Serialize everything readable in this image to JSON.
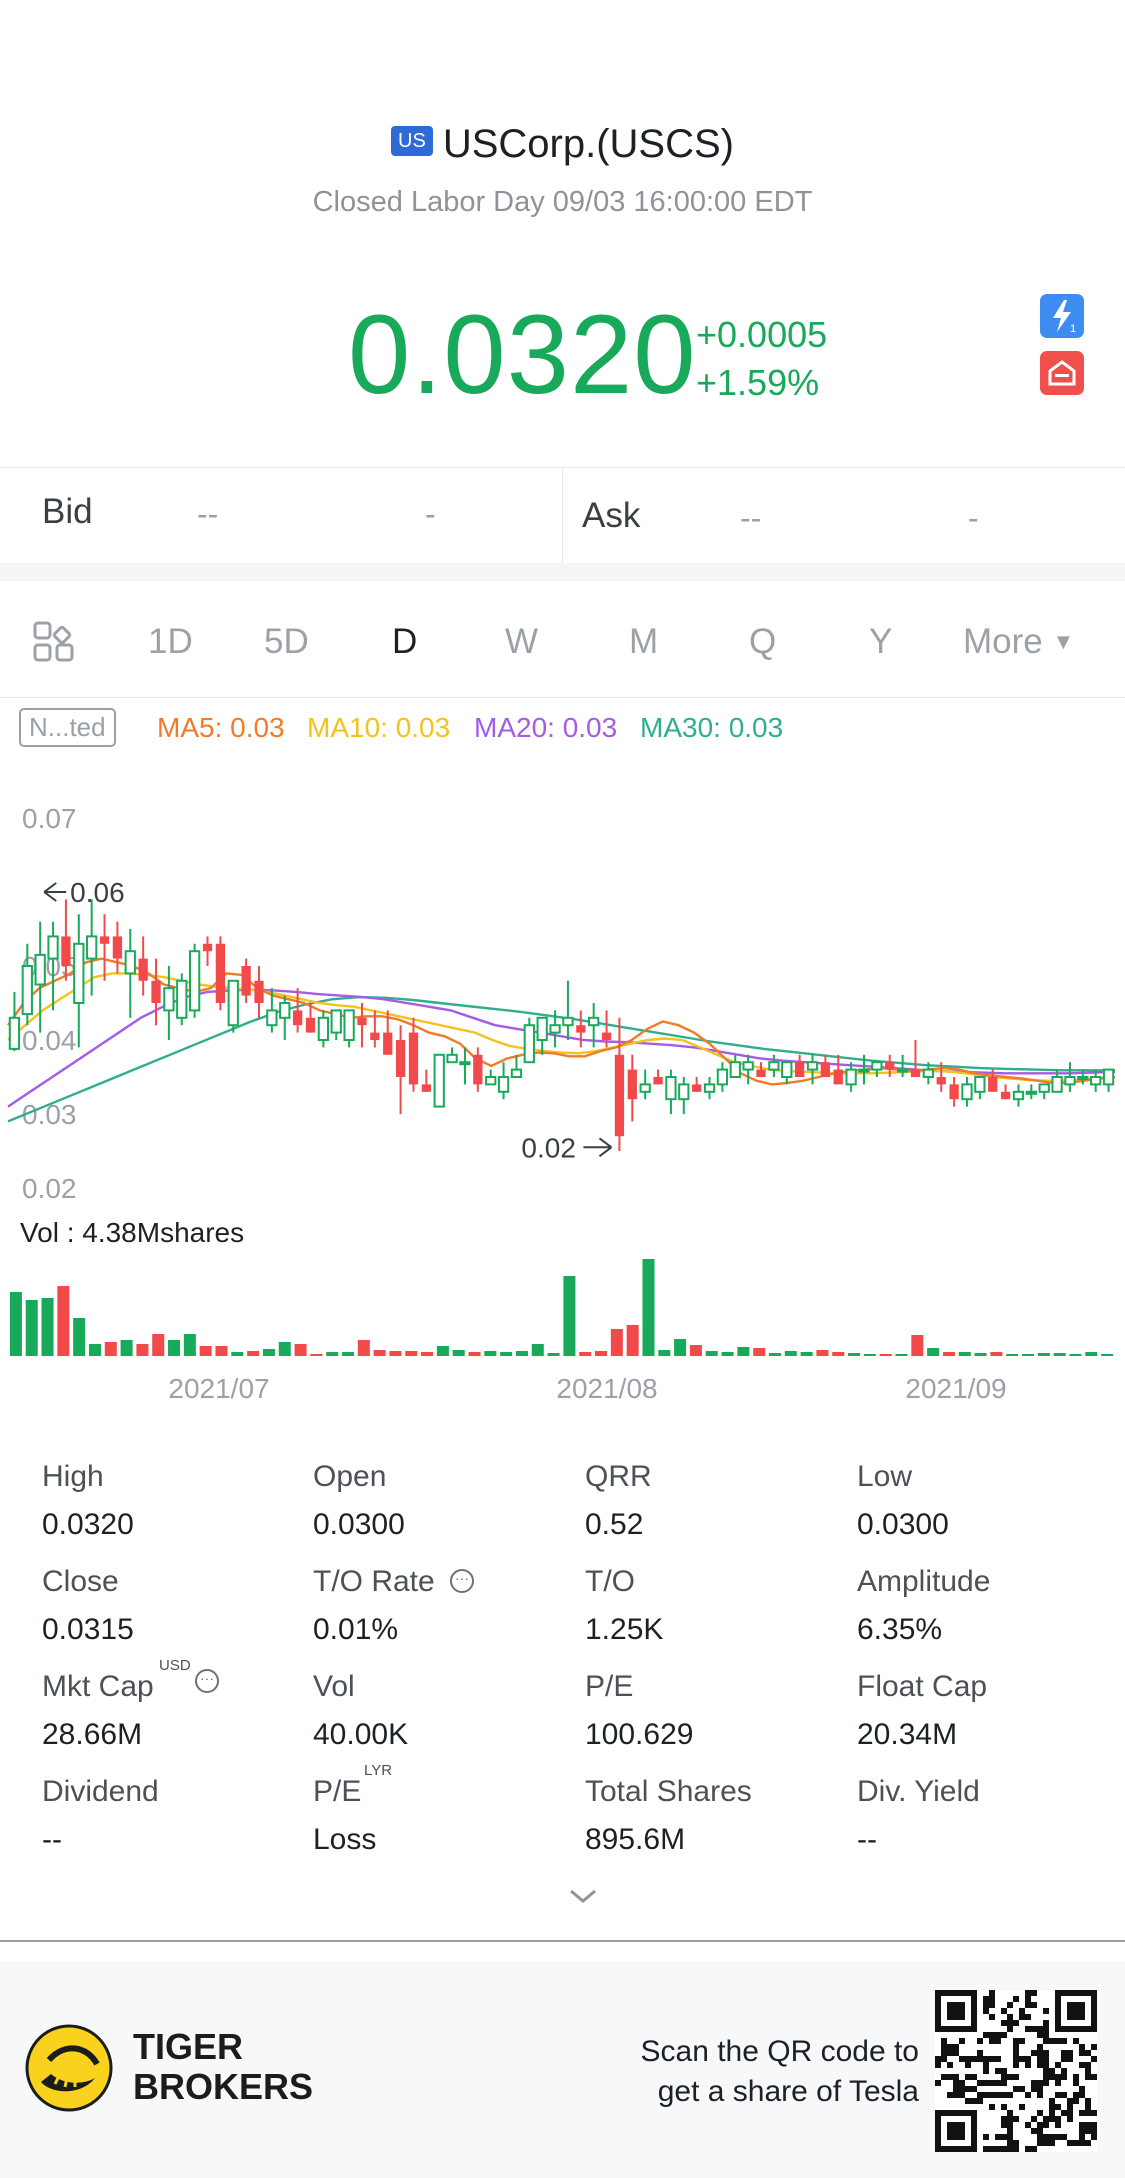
{
  "header": {
    "market_flag": "US",
    "name": "USCorp.(USCS)",
    "status": "Closed Labor Day 09/03 16:00:00 EDT",
    "price": "0.0320",
    "change": "+0.0005",
    "change_pct": "+1.59%",
    "accent_color": "#18a95a"
  },
  "quote": {
    "bid_label": "Bid",
    "bid_price": "--",
    "bid_size": "-",
    "ask_label": "Ask",
    "ask_price": "--",
    "ask_size": "-"
  },
  "tabs": {
    "items": [
      "1D",
      "5D",
      "D",
      "W",
      "M",
      "Q",
      "Y",
      "More"
    ],
    "active": "D"
  },
  "indicators": {
    "mode_label": "N...ted",
    "ma5": "MA5: 0.03",
    "ma10": "MA10: 0.03",
    "ma20": "MA20: 0.03",
    "ma30": "MA30: 0.03",
    "colors": {
      "ma5": "#f07b28",
      "ma10": "#f3c21b",
      "ma20": "#a45ce6",
      "ma30": "#2fae8f"
    }
  },
  "chart_data": {
    "type": "candlestick",
    "y_tick_labels": [
      "0.07",
      "0.05",
      "0.04",
      "0.03",
      "0.02"
    ],
    "ylim": [
      0.02,
      0.07
    ],
    "x_tick_labels": [
      "2021/07",
      "2021/08",
      "2021/09"
    ],
    "max_annotation": "0.06",
    "min_annotation": "0.02",
    "volume_label": "Vol  : 4.38Mshares",
    "colors": {
      "up": "#18a95a",
      "down": "#f24a4a"
    },
    "candles": [
      {
        "o": 0.0388,
        "h": 0.0465,
        "l": 0.0385,
        "c": 0.043
      },
      {
        "o": 0.0435,
        "h": 0.053,
        "l": 0.042,
        "c": 0.05
      },
      {
        "o": 0.0475,
        "h": 0.056,
        "l": 0.041,
        "c": 0.0515
      },
      {
        "o": 0.051,
        "h": 0.056,
        "l": 0.044,
        "c": 0.054
      },
      {
        "o": 0.054,
        "h": 0.059,
        "l": 0.048,
        "c": 0.05
      },
      {
        "o": 0.045,
        "h": 0.057,
        "l": 0.039,
        "c": 0.053
      },
      {
        "o": 0.051,
        "h": 0.059,
        "l": 0.046,
        "c": 0.054
      },
      {
        "o": 0.054,
        "h": 0.057,
        "l": 0.048,
        "c": 0.053
      },
      {
        "o": 0.054,
        "h": 0.056,
        "l": 0.049,
        "c": 0.051
      },
      {
        "o": 0.049,
        "h": 0.055,
        "l": 0.043,
        "c": 0.052
      },
      {
        "o": 0.051,
        "h": 0.054,
        "l": 0.046,
        "c": 0.048
      },
      {
        "o": 0.048,
        "h": 0.051,
        "l": 0.042,
        "c": 0.045
      },
      {
        "o": 0.044,
        "h": 0.05,
        "l": 0.04,
        "c": 0.047
      },
      {
        "o": 0.043,
        "h": 0.049,
        "l": 0.042,
        "c": 0.048
      },
      {
        "o": 0.044,
        "h": 0.053,
        "l": 0.043,
        "c": 0.052
      },
      {
        "o": 0.053,
        "h": 0.054,
        "l": 0.05,
        "c": 0.052
      },
      {
        "o": 0.053,
        "h": 0.054,
        "l": 0.044,
        "c": 0.045
      },
      {
        "o": 0.042,
        "h": 0.047,
        "l": 0.041,
        "c": 0.048
      },
      {
        "o": 0.05,
        "h": 0.051,
        "l": 0.045,
        "c": 0.046
      },
      {
        "o": 0.048,
        "h": 0.05,
        "l": 0.043,
        "c": 0.045
      },
      {
        "o": 0.042,
        "h": 0.047,
        "l": 0.041,
        "c": 0.044
      },
      {
        "o": 0.043,
        "h": 0.046,
        "l": 0.04,
        "c": 0.045
      },
      {
        "o": 0.044,
        "h": 0.047,
        "l": 0.041,
        "c": 0.042
      },
      {
        "o": 0.043,
        "h": 0.045,
        "l": 0.041,
        "c": 0.041
      },
      {
        "o": 0.04,
        "h": 0.044,
        "l": 0.039,
        "c": 0.043
      },
      {
        "o": 0.041,
        "h": 0.044,
        "l": 0.04,
        "c": 0.044
      },
      {
        "o": 0.04,
        "h": 0.044,
        "l": 0.039,
        "c": 0.044
      },
      {
        "o": 0.043,
        "h": 0.045,
        "l": 0.039,
        "c": 0.042
      },
      {
        "o": 0.041,
        "h": 0.044,
        "l": 0.039,
        "c": 0.04
      },
      {
        "o": 0.041,
        "h": 0.044,
        "l": 0.039,
        "c": 0.038
      },
      {
        "o": 0.04,
        "h": 0.042,
        "l": 0.03,
        "c": 0.035
      },
      {
        "o": 0.041,
        "h": 0.043,
        "l": 0.033,
        "c": 0.034
      },
      {
        "o": 0.034,
        "h": 0.036,
        "l": 0.033,
        "c": 0.033
      },
      {
        "o": 0.031,
        "h": 0.038,
        "l": 0.031,
        "c": 0.038
      },
      {
        "o": 0.037,
        "h": 0.039,
        "l": 0.037,
        "c": 0.038
      },
      {
        "o": 0.037,
        "h": 0.039,
        "l": 0.034,
        "c": 0.037
      },
      {
        "o": 0.038,
        "h": 0.039,
        "l": 0.033,
        "c": 0.034
      },
      {
        "o": 0.034,
        "h": 0.036,
        "l": 0.034,
        "c": 0.035
      },
      {
        "o": 0.033,
        "h": 0.037,
        "l": 0.032,
        "c": 0.035
      },
      {
        "o": 0.035,
        "h": 0.038,
        "l": 0.035,
        "c": 0.036
      },
      {
        "o": 0.037,
        "h": 0.043,
        "l": 0.037,
        "c": 0.042
      },
      {
        "o": 0.04,
        "h": 0.043,
        "l": 0.038,
        "c": 0.043
      },
      {
        "o": 0.041,
        "h": 0.044,
        "l": 0.039,
        "c": 0.042
      },
      {
        "o": 0.042,
        "h": 0.048,
        "l": 0.04,
        "c": 0.043
      },
      {
        "o": 0.042,
        "h": 0.044,
        "l": 0.039,
        "c": 0.041
      },
      {
        "o": 0.042,
        "h": 0.045,
        "l": 0.039,
        "c": 0.043
      },
      {
        "o": 0.041,
        "h": 0.044,
        "l": 0.039,
        "c": 0.04
      },
      {
        "o": 0.038,
        "h": 0.043,
        "l": 0.025,
        "c": 0.027
      },
      {
        "o": 0.036,
        "h": 0.038,
        "l": 0.029,
        "c": 0.032
      },
      {
        "o": 0.033,
        "h": 0.036,
        "l": 0.032,
        "c": 0.034
      },
      {
        "o": 0.035,
        "h": 0.036,
        "l": 0.034,
        "c": 0.034
      },
      {
        "o": 0.032,
        "h": 0.036,
        "l": 0.03,
        "c": 0.035
      },
      {
        "o": 0.032,
        "h": 0.035,
        "l": 0.03,
        "c": 0.034
      },
      {
        "o": 0.034,
        "h": 0.035,
        "l": 0.033,
        "c": 0.033
      },
      {
        "o": 0.033,
        "h": 0.035,
        "l": 0.032,
        "c": 0.034
      },
      {
        "o": 0.034,
        "h": 0.037,
        "l": 0.033,
        "c": 0.036
      },
      {
        "o": 0.035,
        "h": 0.038,
        "l": 0.035,
        "c": 0.037
      },
      {
        "o": 0.036,
        "h": 0.038,
        "l": 0.034,
        "c": 0.037
      },
      {
        "o": 0.036,
        "h": 0.037,
        "l": 0.035,
        "c": 0.035
      },
      {
        "o": 0.036,
        "h": 0.038,
        "l": 0.035,
        "c": 0.037
      },
      {
        "o": 0.035,
        "h": 0.037,
        "l": 0.034,
        "c": 0.037
      },
      {
        "o": 0.037,
        "h": 0.038,
        "l": 0.035,
        "c": 0.035
      },
      {
        "o": 0.036,
        "h": 0.038,
        "l": 0.034,
        "c": 0.037
      },
      {
        "o": 0.037,
        "h": 0.038,
        "l": 0.035,
        "c": 0.035
      },
      {
        "o": 0.036,
        "h": 0.038,
        "l": 0.035,
        "c": 0.034
      },
      {
        "o": 0.034,
        "h": 0.037,
        "l": 0.033,
        "c": 0.036
      },
      {
        "o": 0.036,
        "h": 0.038,
        "l": 0.034,
        "c": 0.036
      },
      {
        "o": 0.036,
        "h": 0.037,
        "l": 0.035,
        "c": 0.037
      },
      {
        "o": 0.037,
        "h": 0.038,
        "l": 0.035,
        "c": 0.036
      },
      {
        "o": 0.036,
        "h": 0.038,
        "l": 0.035,
        "c": 0.036
      },
      {
        "o": 0.036,
        "h": 0.04,
        "l": 0.035,
        "c": 0.035
      },
      {
        "o": 0.035,
        "h": 0.037,
        "l": 0.034,
        "c": 0.036
      },
      {
        "o": 0.035,
        "h": 0.037,
        "l": 0.033,
        "c": 0.034
      },
      {
        "o": 0.034,
        "h": 0.035,
        "l": 0.031,
        "c": 0.032
      },
      {
        "o": 0.032,
        "h": 0.035,
        "l": 0.031,
        "c": 0.034
      },
      {
        "o": 0.033,
        "h": 0.035,
        "l": 0.032,
        "c": 0.035
      },
      {
        "o": 0.035,
        "h": 0.036,
        "l": 0.033,
        "c": 0.033
      },
      {
        "o": 0.033,
        "h": 0.034,
        "l": 0.032,
        "c": 0.032
      },
      {
        "o": 0.032,
        "h": 0.034,
        "l": 0.031,
        "c": 0.033
      },
      {
        "o": 0.033,
        "h": 0.034,
        "l": 0.032,
        "c": 0.033
      },
      {
        "o": 0.033,
        "h": 0.034,
        "l": 0.032,
        "c": 0.034
      },
      {
        "o": 0.033,
        "h": 0.036,
        "l": 0.033,
        "c": 0.035
      },
      {
        "o": 0.034,
        "h": 0.037,
        "l": 0.033,
        "c": 0.035
      },
      {
        "o": 0.035,
        "h": 0.036,
        "l": 0.034,
        "c": 0.035
      },
      {
        "o": 0.034,
        "h": 0.036,
        "l": 0.033,
        "c": 0.035
      },
      {
        "o": 0.034,
        "h": 0.036,
        "l": 0.033,
        "c": 0.036
      }
    ],
    "volume": [
      0.64,
      0.56,
      0.58,
      0.7,
      0.38,
      0.12,
      0.14,
      0.16,
      0.12,
      0.22,
      0.16,
      0.22,
      0.1,
      0.1,
      0.04,
      0.05,
      0.07,
      0.14,
      0.12,
      0.02,
      0.04,
      0.04,
      0.16,
      0.06,
      0.05,
      0.05,
      0.04,
      0.1,
      0.06,
      0.04,
      0.05,
      0.04,
      0.05,
      0.12,
      0.03,
      0.8,
      0.04,
      0.05,
      0.27,
      0.31,
      0.97,
      0.06,
      0.17,
      0.11,
      0.05,
      0.04,
      0.09,
      0.08,
      0.03,
      0.05,
      0.04,
      0.06,
      0.04,
      0.03,
      0.02,
      0.02,
      0.02,
      0.21,
      0.08,
      0.04,
      0.04,
      0.03,
      0.04,
      0.02,
      0.02,
      0.03,
      0.03,
      0.02,
      0.04,
      0.02
    ],
    "ma5": [
      0.042,
      0.045,
      0.047,
      0.048,
      0.049,
      0.0505,
      0.051,
      0.0505,
      0.05,
      0.049,
      0.0475,
      0.047,
      0.0465,
      0.047,
      0.049,
      0.0488,
      0.047,
      0.046,
      0.0455,
      0.045,
      0.044,
      0.0435,
      0.043,
      0.0432,
      0.0432,
      0.0428,
      0.042,
      0.041,
      0.0405,
      0.0395,
      0.0375,
      0.0365,
      0.0375,
      0.038,
      0.0383,
      0.0382,
      0.0378,
      0.0378,
      0.0385,
      0.039,
      0.04,
      0.0415,
      0.0425,
      0.042,
      0.041,
      0.0395,
      0.0375,
      0.0355,
      0.0345,
      0.034,
      0.0342,
      0.0345,
      0.035,
      0.0355,
      0.0358,
      0.036,
      0.0362,
      0.036,
      0.0358,
      0.036,
      0.0362,
      0.036,
      0.0355,
      0.0352,
      0.035,
      0.0348,
      0.0345,
      0.0342,
      0.0342,
      0.0345,
      0.0348,
      0.035
    ],
    "ma10": [
      0.04,
      0.042,
      0.044,
      0.0455,
      0.047,
      0.0485,
      0.049,
      0.049,
      0.0488,
      0.0485,
      0.048,
      0.0475,
      0.0472,
      0.047,
      0.0468,
      0.0465,
      0.046,
      0.0455,
      0.045,
      0.0447,
      0.0445,
      0.044,
      0.0435,
      0.043,
      0.0425,
      0.042,
      0.0415,
      0.041,
      0.04,
      0.0392,
      0.0388,
      0.0385,
      0.0383,
      0.0382,
      0.0385,
      0.039,
      0.0395,
      0.04,
      0.0402,
      0.04,
      0.039,
      0.038,
      0.037,
      0.0365,
      0.036,
      0.0358,
      0.0357,
      0.0356,
      0.0355,
      0.0355,
      0.0355,
      0.0356,
      0.0357,
      0.0358,
      0.0358,
      0.0356,
      0.0353,
      0.035,
      0.0348,
      0.0346,
      0.0345,
      0.0345,
      0.0346,
      0.0348,
      0.035
    ],
    "ma20": [
      0.031,
      0.033,
      0.035,
      0.037,
      0.039,
      0.041,
      0.043,
      0.0445,
      0.0458,
      0.0465,
      0.0467,
      0.0468,
      0.0467,
      0.0465,
      0.0462,
      0.046,
      0.0458,
      0.0455,
      0.045,
      0.0445,
      0.044,
      0.043,
      0.042,
      0.0415,
      0.041,
      0.0405,
      0.04,
      0.0398,
      0.0397,
      0.0395,
      0.0393,
      0.039,
      0.0385,
      0.038,
      0.0375,
      0.0372,
      0.037,
      0.0368,
      0.0366,
      0.0364,
      0.0362,
      0.036,
      0.0358,
      0.0357,
      0.0356,
      0.0355,
      0.0355,
      0.0355,
      0.0355,
      0.0356,
      0.0357
    ],
    "ma30": [
      0.029,
      0.0305,
      0.032,
      0.0335,
      0.035,
      0.0365,
      0.038,
      0.0395,
      0.041,
      0.0425,
      0.0438,
      0.0448,
      0.0455,
      0.0458,
      0.0457,
      0.0454,
      0.045,
      0.0446,
      0.0442,
      0.0438,
      0.0433,
      0.0428,
      0.0422,
      0.0416,
      0.041,
      0.0404,
      0.0398,
      0.0393,
      0.0388,
      0.0384,
      0.038,
      0.0376,
      0.0372,
      0.0369,
      0.0366,
      0.0364,
      0.0362,
      0.0361,
      0.036,
      0.0359,
      0.0359,
      0.0359
    ]
  },
  "stats": [
    {
      "label": "High",
      "value": "0.0320"
    },
    {
      "label": "Open",
      "value": "0.0300"
    },
    {
      "label": "QRR",
      "value": "0.52"
    },
    {
      "label": "Low",
      "value": "0.0300"
    },
    {
      "label": "Close",
      "value": "0.0315"
    },
    {
      "label": "T/O Rate",
      "value": "0.01%"
    },
    {
      "label": "T/O",
      "value": "1.25K"
    },
    {
      "label": "Amplitude",
      "value": "6.35%"
    },
    {
      "label": "Mkt Cap",
      "value": "28.66M"
    },
    {
      "label": "Vol",
      "value": "40.00K"
    },
    {
      "label": "P/E",
      "value": "100.629"
    },
    {
      "label": "Float Cap",
      "value": "20.34M"
    },
    {
      "label": "Dividend",
      "value": "--"
    },
    {
      "label": "P/E",
      "value": "Loss"
    },
    {
      "label": "Total Shares",
      "value": "895.6M"
    },
    {
      "label": "Div. Yield",
      "value": "--"
    }
  ],
  "stat_sups": {
    "mkt_cap": "USD",
    "pe_lyr": "LYR"
  },
  "footer": {
    "brand_line1": "TIGER",
    "brand_line2": "BROKERS",
    "cta_line1": "Scan the QR code to",
    "cta_line2": "get a share of Tesla"
  }
}
